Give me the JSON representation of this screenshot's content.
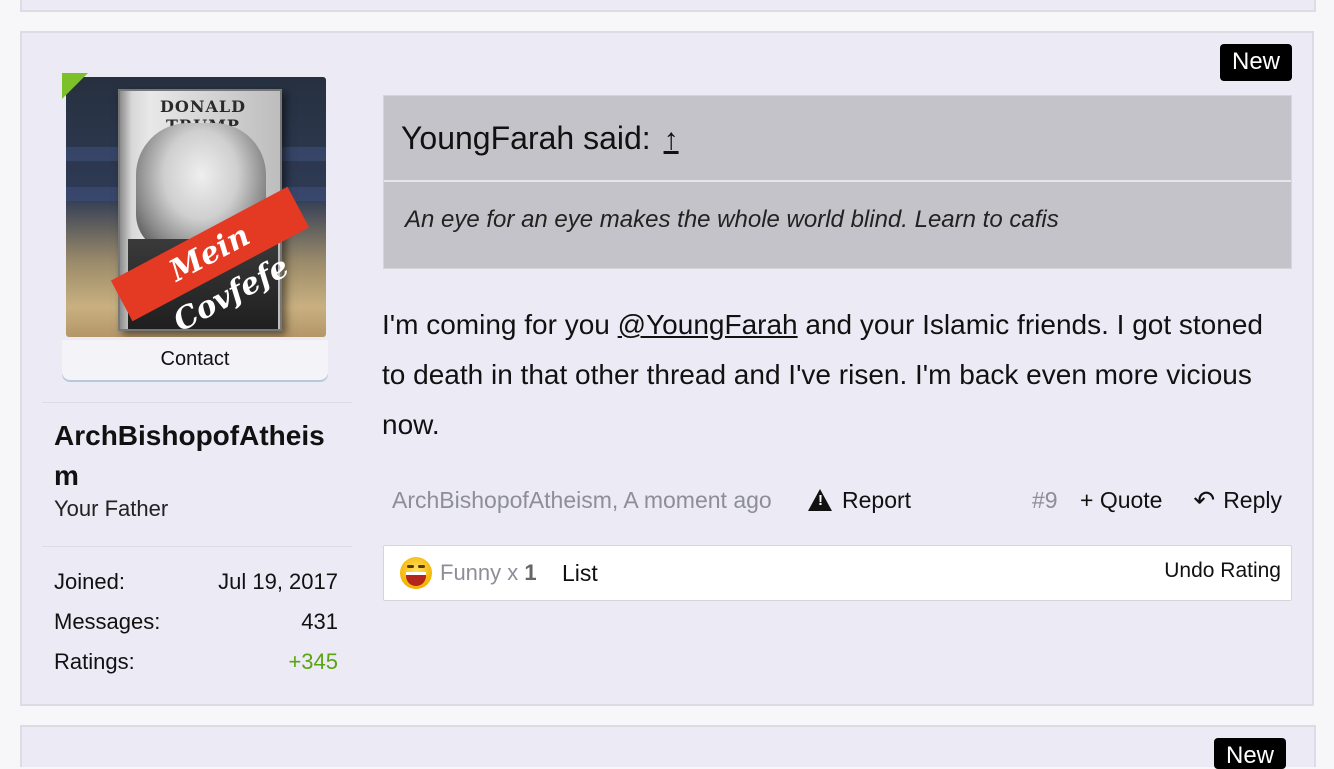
{
  "badge": {
    "new_label": "New"
  },
  "user": {
    "contact_label": "Contact",
    "username": "ArchBishopofAtheism",
    "title": "Your Father",
    "stats": {
      "joined_label": "Joined:",
      "joined_value": "Jul 19, 2017",
      "messages_label": "Messages:",
      "messages_value": "431",
      "ratings_label": "Ratings:",
      "ratings_value": "+345"
    },
    "avatar": {
      "book_title": "DONALD TRUMP",
      "band_text": "Mein Covfefe"
    }
  },
  "quote": {
    "author_line": "YoungFarah said:",
    "arrow": "↑",
    "text": "An eye for an eye makes the whole world blind. Learn to cafis"
  },
  "message": {
    "before": "I'm coming for you ",
    "mention": "@YoungFarah",
    "after": " and your Islamic friends. I got stoned to death in that other thread and I've risen. I'm back even more vicious now."
  },
  "meta": {
    "author_time": "ArchBishopofAtheism, A moment ago",
    "report_label": "Report",
    "post_number": "#9",
    "quote_label": "+ Quote",
    "reply_label": "Reply"
  },
  "ratings": {
    "rating_name": "Funny",
    "x_label": "x",
    "count": "1",
    "list_label": "List",
    "undo_label": "Undo Rating"
  },
  "colors": {
    "positive": "#5aa50f",
    "online": "#7cc02a",
    "post_bg": "#ebeaf5",
    "quote_bg": "#c4c3c9"
  }
}
